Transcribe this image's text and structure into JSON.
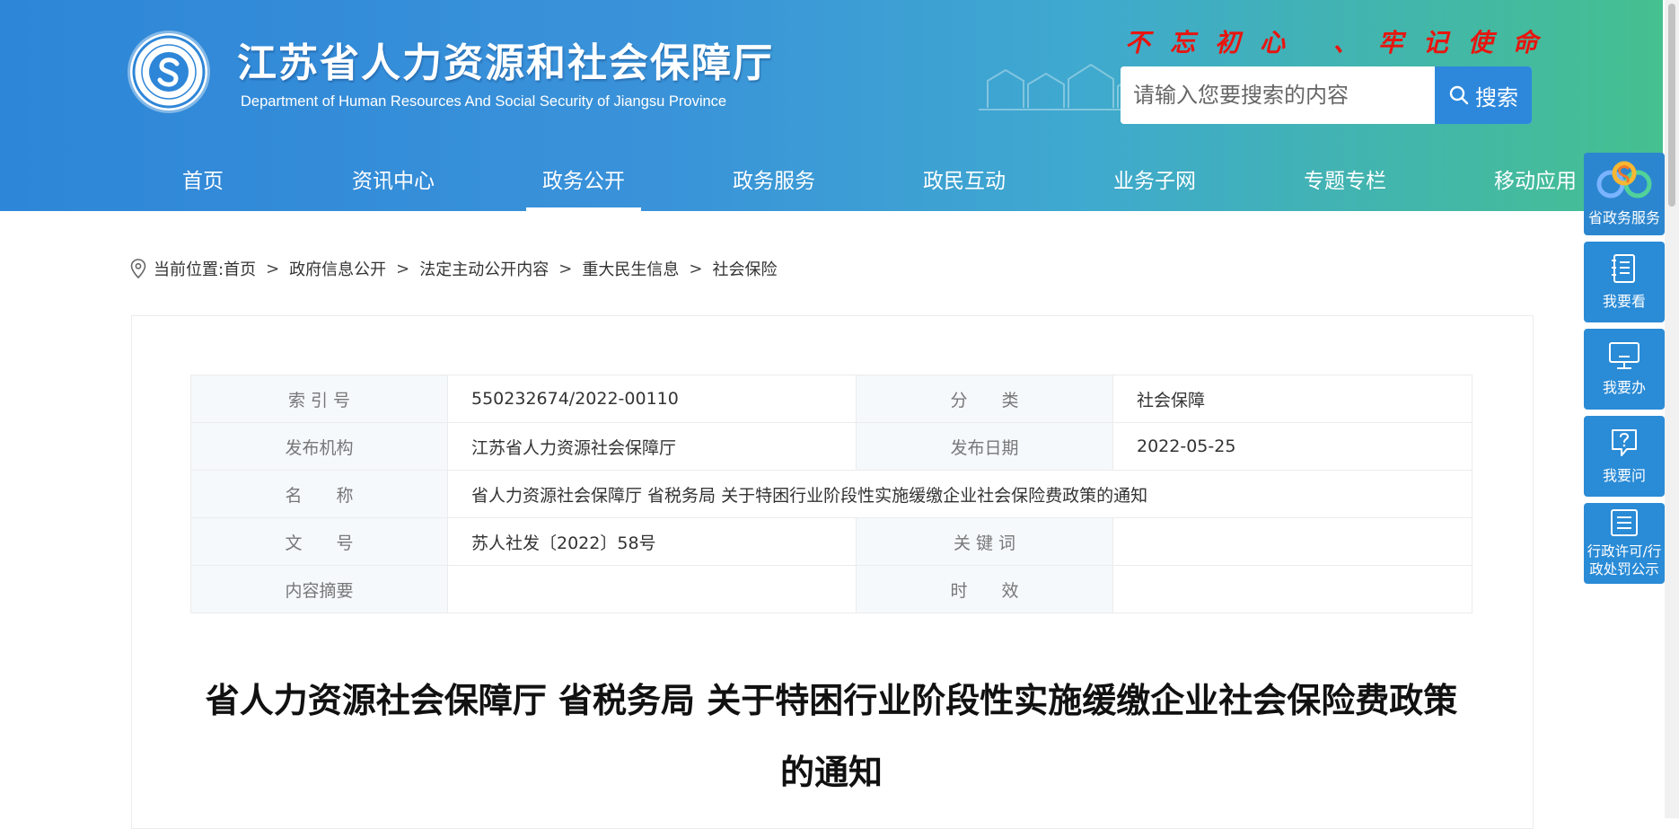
{
  "header": {
    "site_title": "江苏省人力资源和社会保障厅",
    "site_subtitle": "Department of Human Resources And Social Security of Jiangsu Province",
    "slogan": "不忘初心 、牢记使命",
    "search_placeholder": "请输入您要搜索的内容",
    "search_button": "搜索"
  },
  "nav": [
    "首页",
    "资讯中心",
    "政务公开",
    "政务服务",
    "政民互动",
    "业务子网",
    "专题专栏",
    "移动应用"
  ],
  "nav_active": "政务公开",
  "breadcrumb": {
    "label": "当前位置:",
    "items": [
      "首页",
      "政府信息公开",
      "法定主动公开内容",
      "重大民生信息",
      "社会保险"
    ],
    "separator": ">"
  },
  "info": {
    "index_label": "索 引 号",
    "index_value": "550232674/2022-00110",
    "category_label": "分　　类",
    "category_value": "社会保障",
    "publisher_label": "发布机构",
    "publisher_value": "江苏省人力资源社会保障厅",
    "date_label": "发布日期",
    "date_value": "2022-05-25",
    "name_label": "名　　称",
    "name_value": "省人力资源社会保障厅 省税务局 关于特困行业阶段性实施缓缴企业社会保险费政策的通知",
    "docno_label": "文　　号",
    "docno_value": "苏人社发〔2022〕58号",
    "keyword_label": "关 键 词",
    "keyword_value": "",
    "summary_label": "内容摘要",
    "summary_value": "",
    "validity_label": "时　　效",
    "validity_value": ""
  },
  "doc_title": "省人力资源社会保障厅 省税务局 关于特困行业阶段性实施缓缴企业社会保险费政策的通知",
  "side_float": [
    {
      "label": "省政务服务",
      "icon": "gov-service-icon"
    },
    {
      "label": "我要看",
      "icon": "book-icon"
    },
    {
      "label": "我要办",
      "icon": "monitor-icon"
    },
    {
      "label": "我要问",
      "icon": "question-icon"
    },
    {
      "label_line1": "行政许可/行",
      "label_line2": "政处罚公示",
      "icon": "list-icon"
    }
  ],
  "colors": {
    "header_start": "#2e86d8",
    "header_end": "#45c08f",
    "slogan": "#e8150f",
    "side_button": "#2a8bd6"
  }
}
